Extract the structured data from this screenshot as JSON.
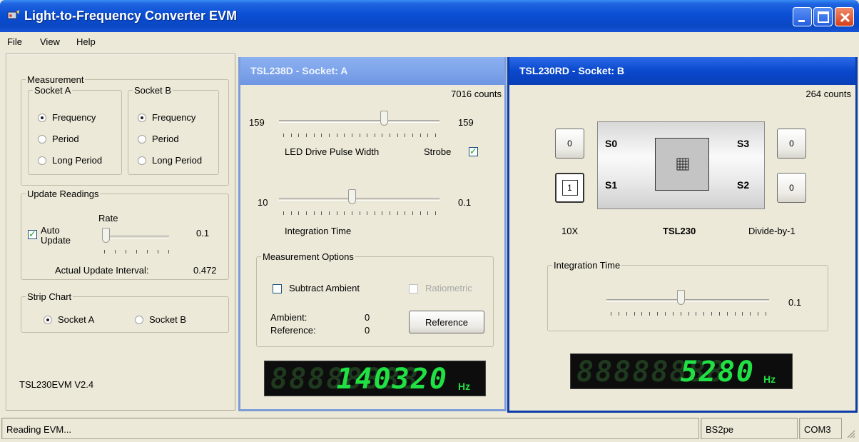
{
  "window": {
    "title": "Light-to-Frequency Converter EVM"
  },
  "menu": [
    "File",
    "View",
    "Help"
  ],
  "left": {
    "measurement_legend": "Measurement",
    "socket_a_legend": "Socket A",
    "socket_b_legend": "Socket B",
    "socket_a_options": [
      {
        "label": "Frequency",
        "selected": true
      },
      {
        "label": "Period",
        "selected": false
      },
      {
        "label": "Long Period",
        "selected": false
      }
    ],
    "socket_b_options": [
      {
        "label": "Frequency",
        "selected": true
      },
      {
        "label": "Period",
        "selected": false
      },
      {
        "label": "Long Period",
        "selected": false
      }
    ],
    "update_legend": "Update Readings",
    "auto_update_label_1": "Auto",
    "auto_update_label_2": "Update",
    "auto_update_checked": true,
    "rate_label": "Rate",
    "rate_value": "0.1",
    "interval_label": "Actual Update Interval:",
    "interval_value": "0.472",
    "strip_legend": "Strip Chart",
    "strip_a": "Socket A",
    "strip_b": "Socket B",
    "strip_selected": "Socket A",
    "version": "TSL230EVM V2.4"
  },
  "socket_a": {
    "header": "TSL238D - Socket: A",
    "counts": "7016  counts",
    "led_min": "159",
    "led_value": "159",
    "led_label": "LED Drive Pulse Width",
    "strobe_label": "Strobe",
    "strobe_checked": true,
    "int_min": "10",
    "int_value": "0.1",
    "int_label": "Integration Time",
    "options_legend": "Measurement Options",
    "subtract_label": "Subtract Ambient",
    "subtract_checked": false,
    "ratiometric_label": "Ratiometric",
    "ambient_label": "Ambient:",
    "ambient_value": "0",
    "reference_label": "Reference:",
    "reference_value": "0",
    "reference_button": "Reference",
    "display_value": "140320",
    "display_ghost": "88888888",
    "display_unit": "Hz"
  },
  "socket_b": {
    "header": "TSL230RD - Socket: B",
    "counts": "264  counts",
    "s0_btn": "0",
    "s1_btn": "1",
    "s3_btn": "0",
    "s2_btn": "0",
    "s0": "S0",
    "s1": "S1",
    "s2": "S2",
    "s3": "S3",
    "gain_label": "10X",
    "chip_label": "TSL230",
    "divide_label": "Divide-by-1",
    "int_legend": "Integration Time",
    "int_value": "0.1",
    "display_value": "5280",
    "display_ghost": "88888888",
    "display_unit": "Hz"
  },
  "status": {
    "message": "Reading EVM...",
    "device": "BS2pe",
    "port": "COM3"
  },
  "colors": {
    "window_bg": "#ece9d8",
    "title_bar": "#0a47c4",
    "lcd_digit": "#21e043",
    "lcd_bg": "#0d0d0d"
  }
}
